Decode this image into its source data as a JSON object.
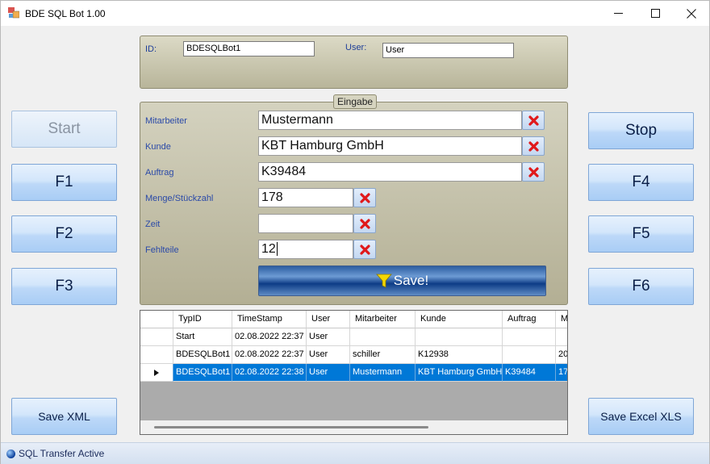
{
  "window": {
    "title": "BDE SQL Bot 1.00"
  },
  "titlebar": {
    "minimize": "—",
    "maximize": "☐",
    "close": "✕"
  },
  "left_buttons": {
    "start": "Start",
    "f1": "F1",
    "f2": "F2",
    "f3": "F3",
    "save_xml": "Save XML"
  },
  "right_buttons": {
    "stop": "Stop",
    "f4": "F4",
    "f5": "F5",
    "f6": "F6",
    "save_xls": "Save Excel XLS"
  },
  "top_panel": {
    "id_label": "ID:",
    "id_value": "BDESQLBot1",
    "user_label": "User:",
    "user_value": "User"
  },
  "input_panel": {
    "group_title": "Eingabe",
    "fields": [
      {
        "label": "Mitarbeiter",
        "value": "Mustermann"
      },
      {
        "label": "Kunde",
        "value": "KBT Hamburg GmbH"
      },
      {
        "label": "Auftrag",
        "value": "K39484"
      },
      {
        "label": "Menge/Stückzahl",
        "value": "178"
      },
      {
        "label": "Zeit",
        "value": ""
      },
      {
        "label": "Fehlteile",
        "value": "12"
      }
    ],
    "save_label": "Save!"
  },
  "grid": {
    "columns": [
      "TypID",
      "TimeStamp",
      "User",
      "Mitarbeiter",
      "Kunde",
      "Auftrag",
      "M"
    ],
    "rows": [
      [
        "Start",
        "02.08.2022 22:37",
        "User",
        "",
        "",
        "",
        ""
      ],
      [
        "BDESQLBot1",
        "02.08.2022 22:37",
        "User",
        "schiller",
        "K12938",
        "",
        "20"
      ],
      [
        "BDESQLBot1",
        "02.08.2022 22:38",
        "User",
        "Mustermann",
        "KBT Hamburg GmbH",
        "K39484",
        "17"
      ]
    ],
    "selected_row": 2
  },
  "status": {
    "text": "SQL Transfer Active"
  },
  "colors": {
    "selection": "#0078d7",
    "accent": "#0d3c86",
    "error_x": "#e0191b"
  }
}
